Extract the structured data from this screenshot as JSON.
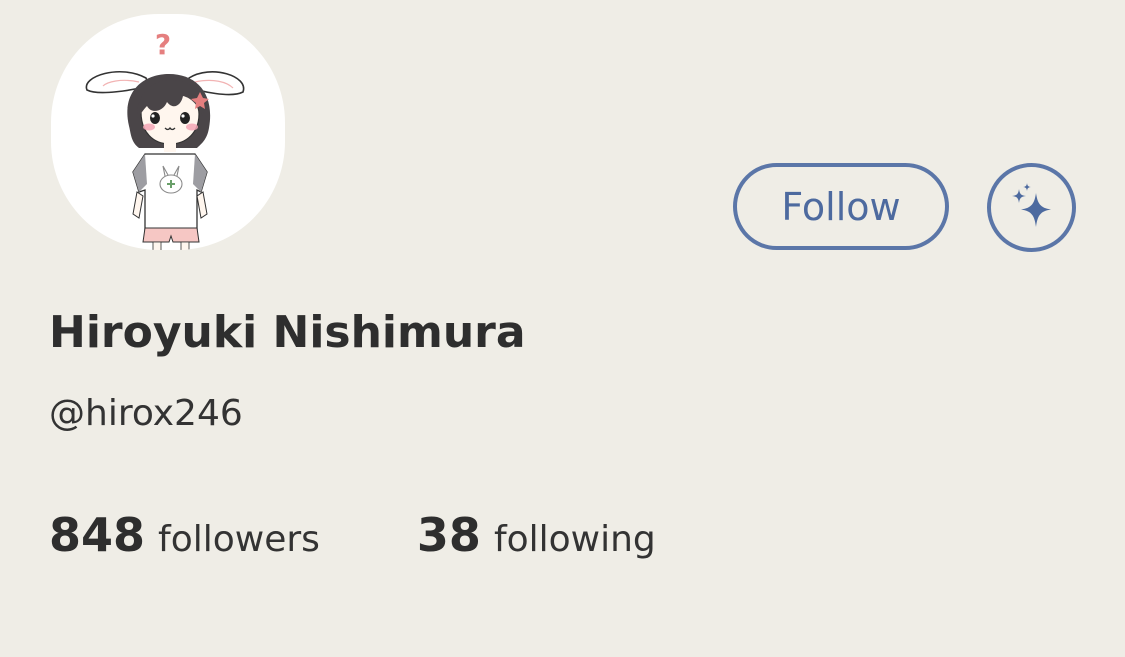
{
  "profile": {
    "avatar_icon": "bunny-girl-illustration",
    "avatar_question_mark": "?",
    "display_name": "Hiroyuki Nishimura",
    "handle": "@hirox246"
  },
  "actions": {
    "follow_label": "Follow",
    "sparkle_icon": "sparkle-icon"
  },
  "stats": {
    "followers_count": "848",
    "followers_label": "followers",
    "following_count": "38",
    "following_label": "following"
  },
  "colors": {
    "background": "#efede6",
    "accent": "#5b76a8",
    "text": "#2e2e2e"
  }
}
